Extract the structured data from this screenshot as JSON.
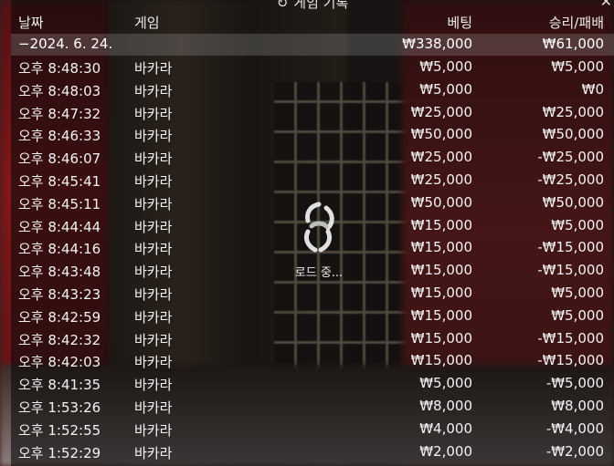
{
  "dialog": {
    "title": "게임 기록",
    "close_glyph": "✕"
  },
  "columns": {
    "date": "날짜",
    "game": "게임",
    "bet": "베팅",
    "result": "승리/패배"
  },
  "summary": {
    "date": "−2024. 6. 24.",
    "bet": "₩338,000",
    "result": "₩61,000"
  },
  "rows": [
    {
      "time": "오후 8:48:30",
      "game": "바카라",
      "bet": "₩5,000",
      "result": "₩5,000"
    },
    {
      "time": "오후 8:48:03",
      "game": "바카라",
      "bet": "₩5,000",
      "result": "₩0"
    },
    {
      "time": "오후 8:47:32",
      "game": "바카라",
      "bet": "₩25,000",
      "result": "₩25,000"
    },
    {
      "time": "오후 8:46:33",
      "game": "바카라",
      "bet": "₩50,000",
      "result": "₩50,000"
    },
    {
      "time": "오후 8:46:07",
      "game": "바카라",
      "bet": "₩25,000",
      "result": "-₩25,000"
    },
    {
      "time": "오후 8:45:41",
      "game": "바카라",
      "bet": "₩25,000",
      "result": "-₩25,000"
    },
    {
      "time": "오후 8:45:11",
      "game": "바카라",
      "bet": "₩50,000",
      "result": "₩50,000"
    },
    {
      "time": "오후 8:44:44",
      "game": "바카라",
      "bet": "₩15,000",
      "result": "₩5,000"
    },
    {
      "time": "오후 8:44:16",
      "game": "바카라",
      "bet": "₩15,000",
      "result": "-₩15,000"
    },
    {
      "time": "오후 8:43:48",
      "game": "바카라",
      "bet": "₩15,000",
      "result": "-₩15,000"
    },
    {
      "time": "오후 8:43:23",
      "game": "바카라",
      "bet": "₩15,000",
      "result": "₩5,000"
    },
    {
      "time": "오후 8:42:59",
      "game": "바카라",
      "bet": "₩15,000",
      "result": "₩5,000"
    },
    {
      "time": "오후 8:42:32",
      "game": "바카라",
      "bet": "₩15,000",
      "result": "-₩15,000"
    },
    {
      "time": "오후 8:42:03",
      "game": "바카라",
      "bet": "₩15,000",
      "result": "-₩15,000"
    },
    {
      "time": "오후 8:41:35",
      "game": "바카라",
      "bet": "₩5,000",
      "result": "-₩5,000"
    },
    {
      "time": "오후 1:53:26",
      "game": "바카라",
      "bet": "₩8,000",
      "result": "₩8,000"
    },
    {
      "time": "오후 1:52:55",
      "game": "바카라",
      "bet": "₩4,000",
      "result": "-₩4,000"
    },
    {
      "time": "오후 1:52:29",
      "game": "바카라",
      "bet": "₩2,000",
      "result": "-₩2,000"
    }
  ],
  "loading": {
    "label": "로드 중..."
  }
}
